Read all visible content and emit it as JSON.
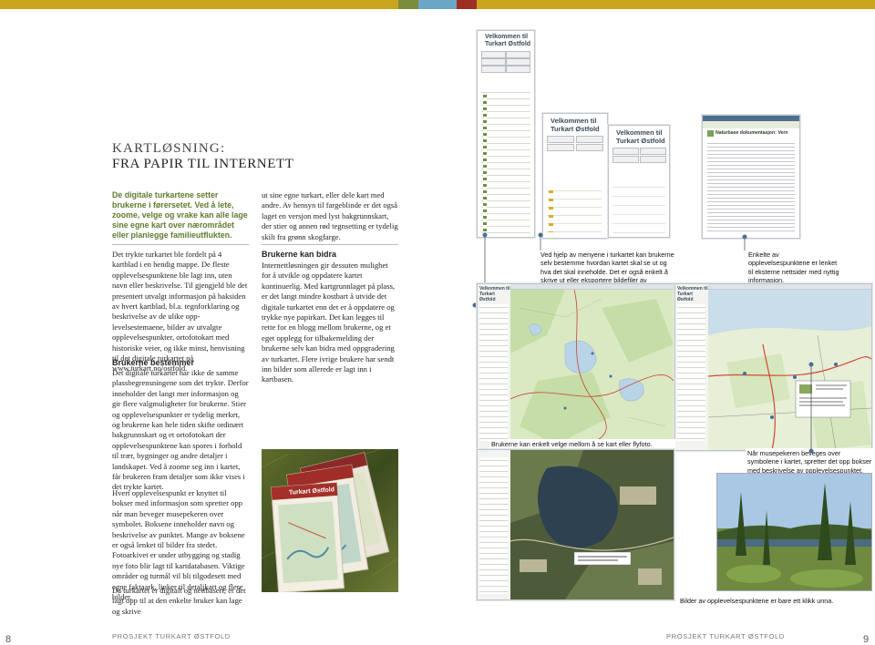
{
  "colors": {
    "band_gold": "#c8a51b",
    "band_green": "#7b8c3c",
    "band_blue": "#6aa7c6",
    "band_red": "#9e2f25"
  },
  "left_page": {
    "title_line1": "KARTLØSNING:",
    "title_line2": "FRA PAPIR TIL INTERNETT",
    "intro": "De digitale turkartene setter brukerne i førersetet. Ved å lete, zoome, velge og vrake kan alle lage sine egne kart over nærområdet eller planlegge familieutflukten.",
    "col1_p1": "Det trykte turkartet ble fordelt på 4 kartblad i en hendig mappe. De fleste opplevelsespunk­tene ble lagt inn, uten navn eller beskrivelse. Til gjengjeld ble det presentert utvalgt infor­masjon på baksiden av hvert kartblad, bl.a. tegnforklaring og beskrivelse av de ulike opp­levelsestemaene, bilder av utvalgte opplevel­sespunkter, ortofotokart med historiske veier, og ikke minst, henvisning til det digitale tur­kartet på www.turkart.no/ostfold.",
    "col1_sub": "Brukerne bestemmer",
    "col1_p2": "Det digitale turkartet har ikke de samme plass­begrensningene som det trykte. Derfor inne­holder det langt mer informasjon og gir flere valgmuligheter for brukerne. Stier og opple­velsespunkter er tydelig merket, og brukerne kan hele tiden skifte ordinært bakgrunnskart og et ortofotokart der opplevelsespunktene kan spores i forhold til trær, bygninger og an­dre detaljer i landskapet. Ved å zoome seg inn i kartet, får brukeren fram detaljer som ikke vises i det trykte kartet.",
    "col1_p3": "Hvert opplevelsespunkt er knyttet til bokser med informasjon som spretter opp når man beveger musepekeren over symbolet. Boksene inneholder navn og beskrivelse av punktet. Mange av boksene er også lenket til bilder fra stedet. Fotoarkivet er under utbygging og sta­dig nye foto blir lagt til kartdatabasen. Viktige områder og turmål vil bli tilgodesett med egne faktaark, linker til detaljkart og flere bilder.",
    "col1_p4": "Da turkartet er digitalt og nettbasert, er det lagt opp til at den enkelte bruker kan lage og skrive",
    "col2_p1": "ut sine egne turkart, eller dele kart med andre. Av hensyn til fargeblinde er det også laget en versjon med lyst bakgrunnskart, der stier og annen rød tegnsetting er tydelig skilt fra grønn skogfarge.",
    "col2_sub": "Brukerne kan bidra",
    "col2_p2": "Internettløsningen gir dessuten mulighet for å utvikle og oppdatere kartet kontinuerlig. Med kartgrunnlaget på plass, er det langt mindre kostbart å utvide det digitale turkartet enn det er å oppdatere og trykke nye papirkart. Det kan legges til rette for en blogg mellom bru­kerne, og et eget opplegg for tilbakemelding der brukerne selv kan bidra med oppgradering av turkartet. Flere ivrige brukere har sendt inn bilder som allerede er lagt inn i kartbasen.",
    "footer": "PROSJEKT TURKART ØSTFOLD",
    "page_number": "8"
  },
  "right_page": {
    "caption_top_middle": "Ved hjelp av menyene i turkartet kan brukerne selv bestemme hvordan kartet skal se ut og hva det skal inneholde. Det er også enkelt å skrive ut eller eksportere bildefiler av kartutsnitt.",
    "caption_top_right": "Enkelte av opplevelsespunktene er lenket til eksterne nettsider med nyttig informasjon.",
    "caption_map_middle": "Brukerne kan enkelt velge mellom å se kart eller flyfoto.",
    "caption_map_right": "Når musepekeren beveges over symbolene i kartet, spretter det opp bokser med beskri­velse av opplevelsespunktet.",
    "caption_bottom_right": "Bilder av opplevelsespunktene er bare ett klikk unna.",
    "footer": "PROSJEKT TURKART ØSTFOLD",
    "page_number": "9"
  },
  "screens": {
    "welcome_line1": "Velkommen til",
    "welcome_line2": "Turkart Østfold",
    "welcome_small": "Velkommen til\nTurkart Østfold",
    "web_header": "Naturbase dokumentasjon: Vern",
    "folder_label": "Turkart Østfold"
  },
  "icons": [
    "map-thumbnail",
    "photo-thumbnail",
    "pointer-dot"
  ]
}
